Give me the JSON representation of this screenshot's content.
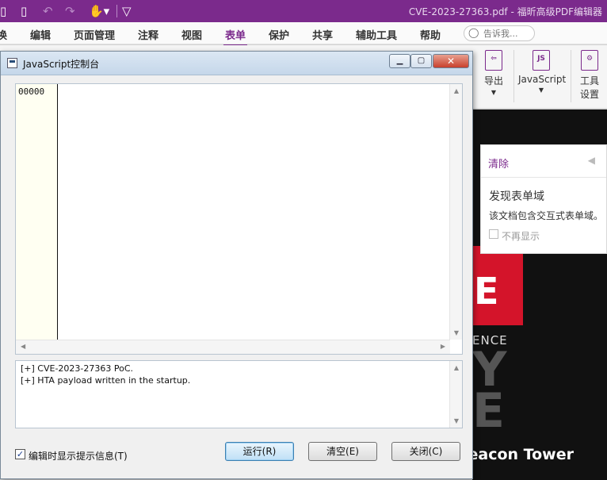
{
  "app": {
    "window_title": "CVE-2023-27363.pdf - 福昕高级PDF编辑器",
    "accent_color": "#7b2a8c",
    "quick_access_icons": [
      "new-document-icon",
      "undo-icon",
      "redo-icon",
      "hand-tool-icon",
      "customize-dropdown-icon"
    ]
  },
  "menu": {
    "items": [
      "换",
      "编辑",
      "页面管理",
      "注释",
      "视图",
      "表单",
      "保护",
      "共享",
      "辅助工具",
      "帮助"
    ],
    "active": "表单",
    "tell_me_placeholder": "告诉我..."
  },
  "ribbon": {
    "export_label": "导出",
    "javascript_label": "JavaScript",
    "javascript_icon_text": "JS",
    "tool_settings_label_1": "工具",
    "tool_settings_label_2": "设置"
  },
  "form_panel": {
    "clear_label": "清除",
    "heading": "发现表单域",
    "description": "该文档包含交互式表单域。",
    "dont_show_label": "不再显示"
  },
  "document": {
    "red_letter": "E",
    "text_line": "ENCE",
    "big_letters": "Y\nE",
    "watermark": "Beacon Tower Lab"
  },
  "dialog": {
    "title": "JavaScript控制台",
    "line_number": "00000",
    "output_lines": [
      "[+] CVE-2023-27363 PoC.",
      "[+] HTA payload written in the startup."
    ],
    "show_hint_label": "编辑时显示提示信息(T)",
    "show_hint_checked": true,
    "run_label": "运行(R)",
    "clear_label": "清空(E)",
    "close_label": "关闭(C)"
  }
}
